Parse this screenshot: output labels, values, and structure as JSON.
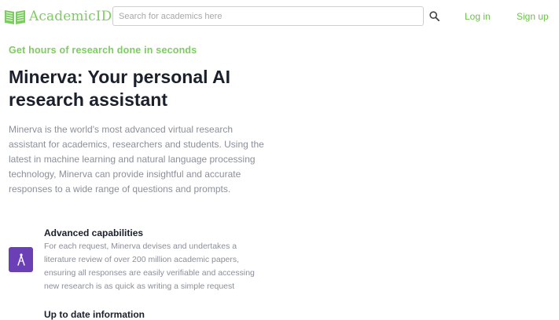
{
  "header": {
    "logo_text": "AcademicID",
    "logo_icon": "open-book-icon",
    "search": {
      "placeholder": "Search for academics here",
      "value": ""
    },
    "search_icon": "search-icon",
    "login_label": "Log in",
    "signup_label": "Sign up"
  },
  "hero": {
    "tagline": "Get hours of research done in seconds",
    "title": "Minerva: Your personal AI research assistant",
    "description": "Minerva is the world's most advanced virtual research assistant for academics, researchers and students. Using the latest in machine learning and natural language processing technology, Minerva can provide insightful and accurate responses to a wide range of questions and prompts."
  },
  "features": [
    {
      "icon": "compass-icon",
      "title": "Advanced capabilities",
      "description": "For each request, Minerva devises and undertakes a literature review of over 200 million academic papers, ensuring all responses are easily verifiable and accessing new research is as quick as writing a simple request"
    },
    {
      "title": "Up to date information"
    }
  ],
  "colors": {
    "brand_green": "#7ccd5f",
    "link_green": "#6cc24a",
    "feature_icon_bg": "#6b3fb5",
    "title_text": "#1a202c",
    "body_text": "#8a8f98"
  }
}
